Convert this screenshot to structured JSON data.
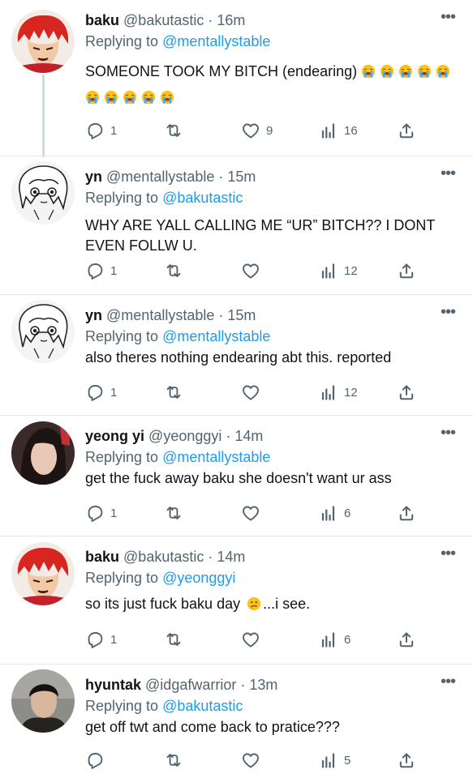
{
  "tweets": [
    {
      "name": "baku",
      "handle": "@bakutastic",
      "dot": "·",
      "time": "16m",
      "replying_prefix": "Replying to",
      "replying_to": "@mentallystable",
      "text": "SOMEONE TOOK MY BITCH (endearing)",
      "emoji_count": 10,
      "reply_count": "1",
      "like_count": "9",
      "views_count": "16"
    },
    {
      "name": "yn",
      "handle": "@mentallystable",
      "dot": "·",
      "time": "15m",
      "replying_prefix": "Replying to",
      "replying_to": "@bakutastic",
      "text": "WHY ARE YALL CALLING ME “UR” BITCH?? I DONT EVEN FOLLW U.",
      "reply_count": "1",
      "like_count": "",
      "views_count": "12"
    },
    {
      "name": "yn",
      "handle": "@mentallystable",
      "dot": "·",
      "time": "15m",
      "replying_prefix": "Replying to",
      "replying_to": "@mentallystable",
      "text": "also theres nothing endearing abt this. reported",
      "reply_count": "1",
      "like_count": "",
      "views_count": "12"
    },
    {
      "name": "yeong yi",
      "handle": "@yeonggyi",
      "dot": "·",
      "time": "14m",
      "replying_prefix": "Replying to",
      "replying_to": "@mentallystable",
      "text": "get the fuck away baku she doesn't want ur ass",
      "reply_count": "1",
      "like_count": "",
      "views_count": "6"
    },
    {
      "name": "baku",
      "handle": "@bakutastic",
      "dot": "·",
      "time": "14m",
      "replying_prefix": "Replying to",
      "replying_to": "@yeonggyi",
      "text_before": "so its just fuck baku day",
      "text_after": "...i see.",
      "reply_count": "1",
      "like_count": "",
      "views_count": "6"
    },
    {
      "name": "hyuntak",
      "handle": "@idgafwarrior",
      "dot": "·",
      "time": "13m",
      "replying_prefix": "Replying to",
      "replying_to": "@bakutastic",
      "text": "get off twt and come back to pratice???",
      "reply_count": "",
      "like_count": "",
      "views_count": "5"
    }
  ],
  "icons": {
    "more": "more-horizontal-icon",
    "reply": "reply-bubble-icon",
    "retweet": "retweet-icon",
    "like": "heart-icon",
    "views": "views-bar-icon",
    "share": "share-upload-icon",
    "loudly_crying": "loudly-crying-face-emoji",
    "confused": "confused-face-emoji"
  },
  "colors": {
    "text": "#0f1419",
    "secondary": "#536471",
    "link": "#1d9bf0",
    "divider": "#e4e8eb",
    "thread_line": "#cfd9de"
  }
}
